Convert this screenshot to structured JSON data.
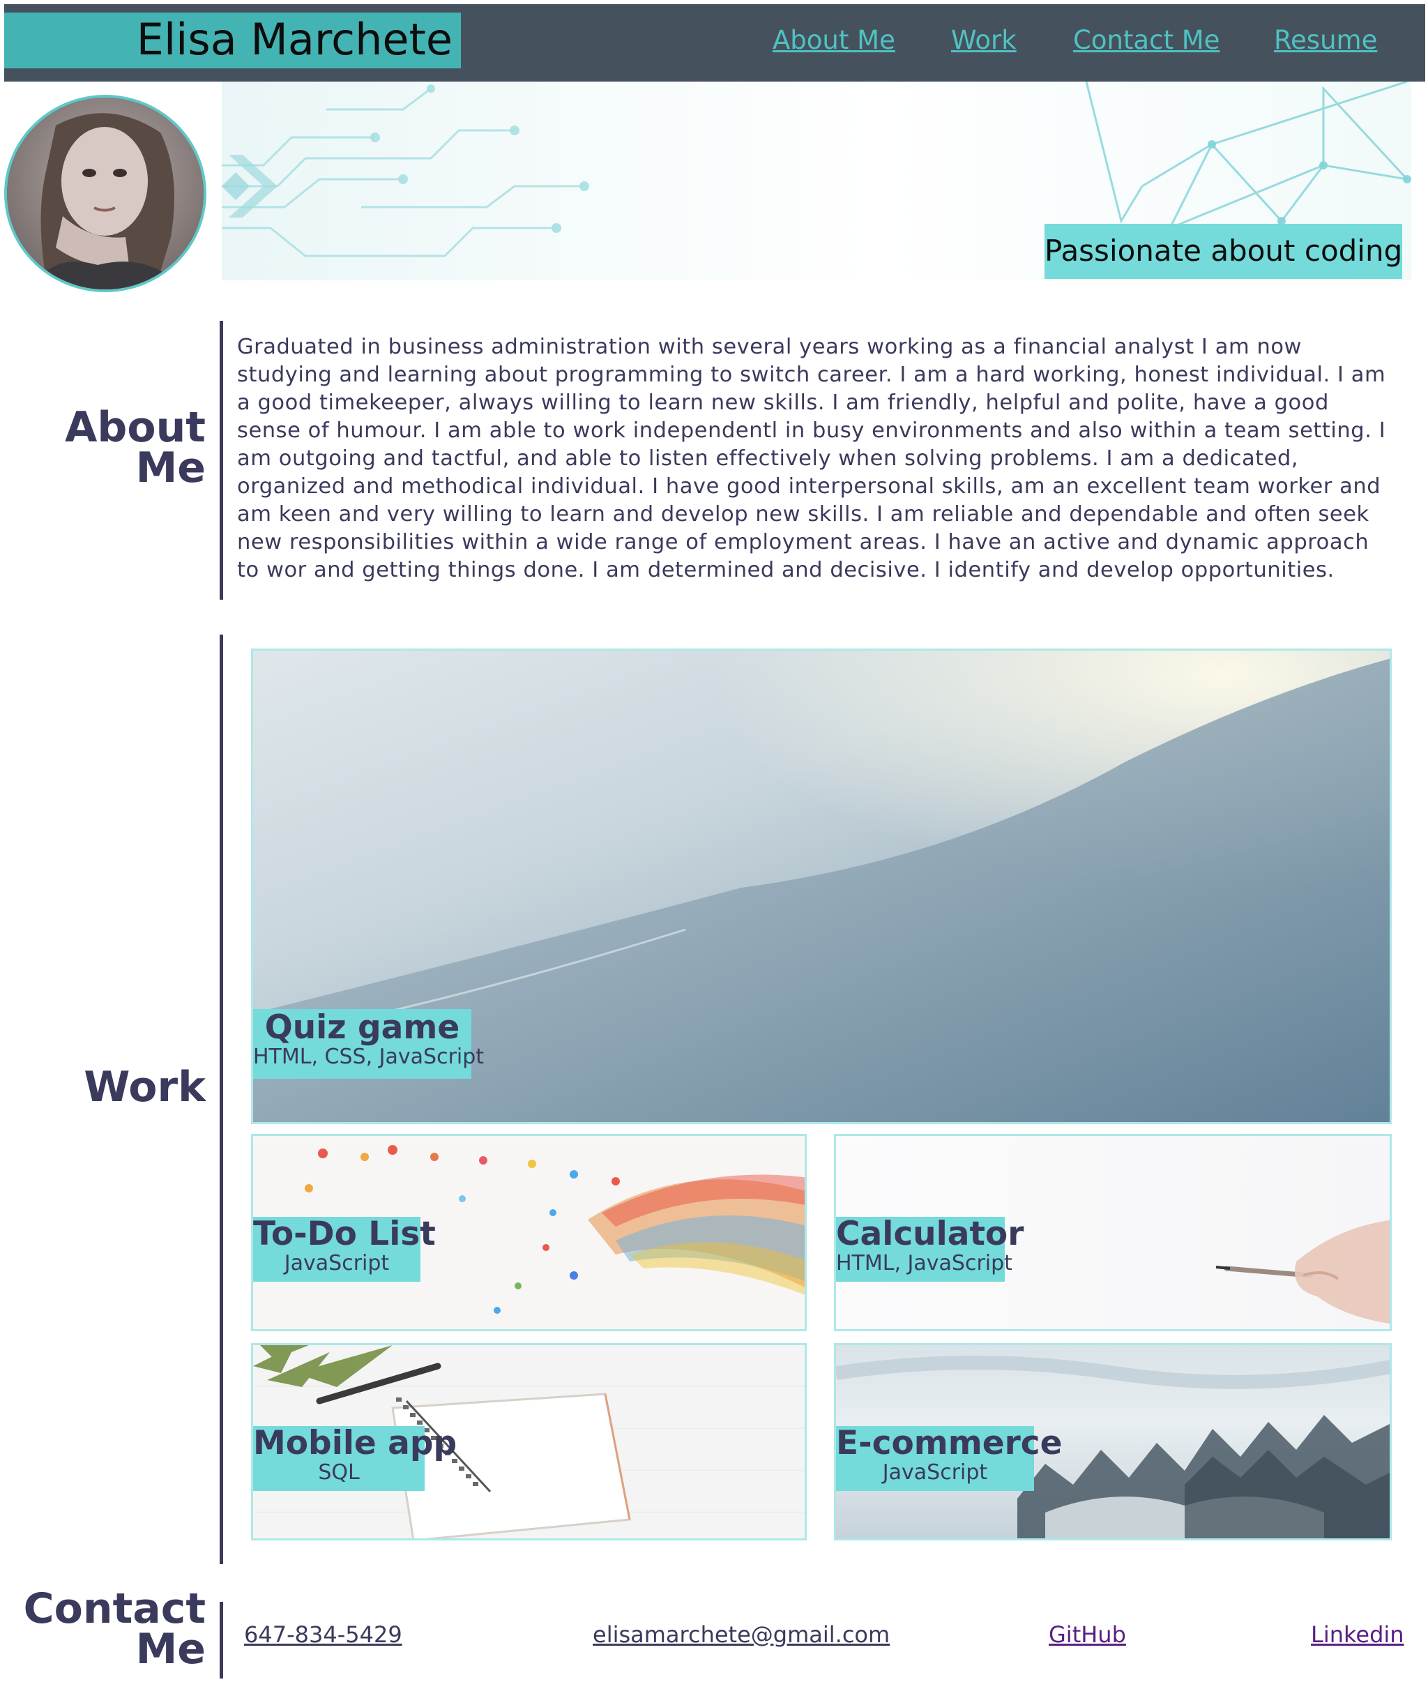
{
  "header": {
    "name": "Elisa Marchete",
    "nav": [
      "About Me",
      "Work",
      "Contact Me",
      "Resume"
    ]
  },
  "hero": {
    "tagline": "Passionate about coding"
  },
  "about": {
    "heading_line1": "About",
    "heading_line2": "Me",
    "text": "Graduated in business administration with several years working as a financial analyst I am now studying and learning about programming to switch career. I am a hard working, honest individual. I am a good timekeeper, always willing to learn new skills. I am friendly, helpful and polite, have a good sense of humour. I am able to work independentl in busy environments and also within a team setting. I am outgoing and tactful, and able to listen effectively when solving problems. I am a dedicated, organized and methodical individual. I have good interpersonal skills, am an excellent team worker and am keen and very willing to learn and develop new skills. I am reliable and dependable and often seek new responsibilities within a wide range of employment areas. I have an active and dynamic approach to wor and getting things done. I am determined and decisive. I identify and develop opportunities."
  },
  "work": {
    "heading": "Work",
    "projects": [
      {
        "title": "Quiz game",
        "tech": "HTML, CSS, JavaScript"
      },
      {
        "title": "To-Do List",
        "tech": "JavaScript"
      },
      {
        "title": "Calculator",
        "tech": "HTML, JavaScript"
      },
      {
        "title": "Mobile app",
        "tech": "SQL"
      },
      {
        "title": "E-commerce",
        "tech": "JavaScript"
      }
    ]
  },
  "contact": {
    "heading_line1": "Contact",
    "heading_line2": "Me",
    "phone": "647-834-5429",
    "email": "elisamarchete@gmail.com",
    "github": "GitHub",
    "linkedin": "Linkedin"
  },
  "colors": {
    "header_bg": "#45525e",
    "name_bg": "#44b3b4",
    "accent": "#74dada",
    "text": "#3a3a5c",
    "nav_link": "#4fc2c2",
    "visited_link": "#5a1f82"
  }
}
